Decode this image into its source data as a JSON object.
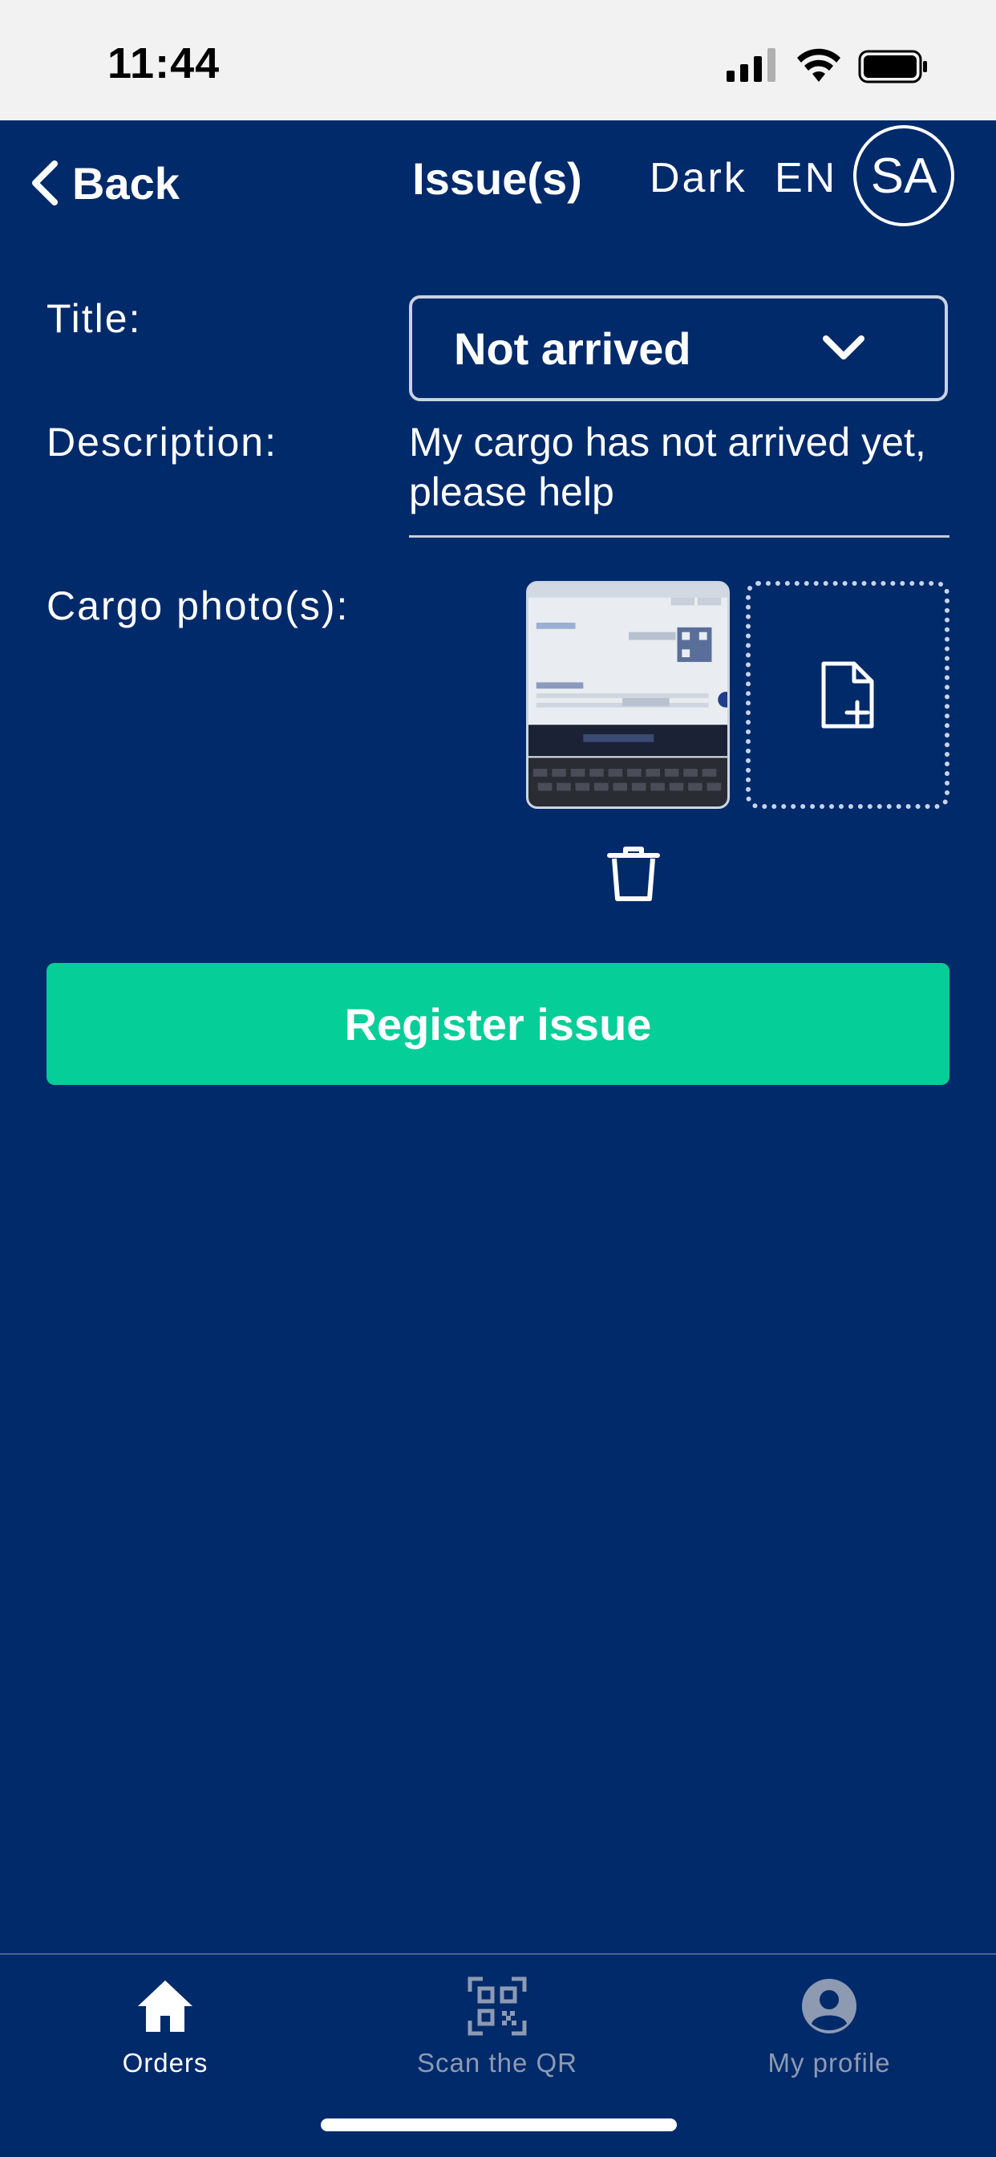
{
  "status_bar": {
    "time": "11:44"
  },
  "header": {
    "back_label": "Back",
    "title": "Issue(s)",
    "theme_label": "Dark",
    "language_label": "EN",
    "avatar_initials": "SA"
  },
  "form": {
    "title_label": "Title:",
    "title_value": "Not arrived",
    "description_label": "Description:",
    "description_value": "My cargo has not arrived yet, please help",
    "photos_label": "Cargo photo(s):",
    "photo_count": 1
  },
  "actions": {
    "register_label": "Register issue"
  },
  "colors": {
    "background": "#002a6a",
    "accent": "#05ce98",
    "status_bar": "#f2f2f2"
  },
  "tabbar": {
    "items": [
      {
        "label": "Orders",
        "icon": "home-icon",
        "active": true
      },
      {
        "label": "Scan the QR",
        "icon": "qr-code-icon",
        "active": false
      },
      {
        "label": "My profile",
        "icon": "user-circle-icon",
        "active": false
      }
    ]
  }
}
